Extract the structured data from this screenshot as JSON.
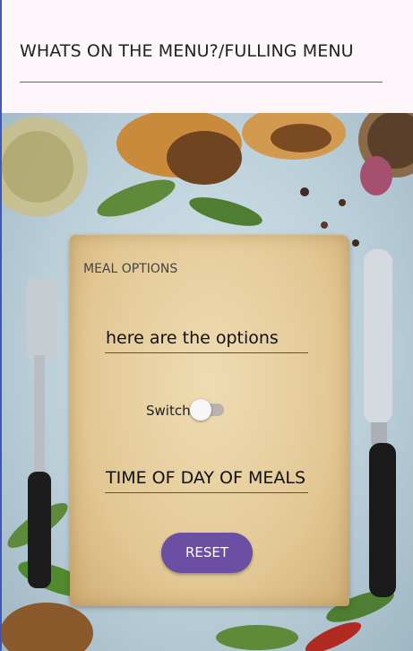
{
  "header": {
    "title": "WHATS ON THE MENU?/FULLING MENU"
  },
  "form": {
    "section_label": "MEAL OPTIONS",
    "options_text": "here are the options",
    "switch_label": "Switch",
    "switch_on": false,
    "time_text": "TIME OF DAY OF MEALS",
    "reset_label": "RESET"
  },
  "colors": {
    "accent": "#6a4fa3",
    "left_edge": "#3f57b8"
  }
}
